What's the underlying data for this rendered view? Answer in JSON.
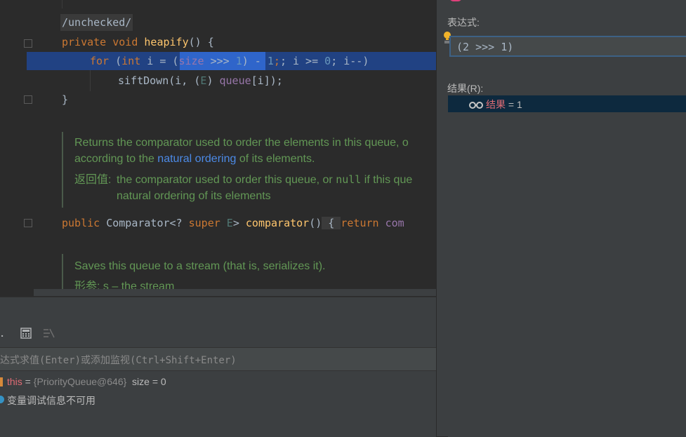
{
  "editor": {
    "comment_unchecked": "/unchecked/",
    "heapify_line": {
      "kw1": "private",
      "kw2": "void",
      "fn": "heapify",
      "rest": "() {"
    },
    "for_line": {
      "kw": "for",
      "open": " (",
      "kw2": "int",
      "mid": " i = ",
      "sel_open": "(",
      "sel_var": "size",
      "sel_op": " >>> ",
      "sel_num": "1",
      "sel_close": ")",
      "after1": " - ",
      "num1": "1",
      "semi1": "; i >= ",
      "num2": "0",
      "semi2": "; i--)"
    },
    "sift_line": {
      "text1": "siftDown(i, (",
      "type": "E",
      "text2": ") ",
      "field": "queue",
      "text3": "[i]);"
    },
    "close_brace": "}",
    "doc1_line1": "Returns the comparator used to order the elements in this queue, o",
    "doc1_line2_a": "according to the ",
    "doc1_line2_link": "natural ordering",
    "doc1_line2_b": " of its elements.",
    "doc1_ret_label": "返回值:",
    "doc1_ret_a": "the comparator used to order this queue, or ",
    "doc1_ret_null": "null",
    "doc1_ret_b": " if this que",
    "doc1_ret_line2": "natural ordering of its elements",
    "comparator_line": {
      "kw1": "public",
      "type": " Comparator<? ",
      "kw2": "super",
      "tp": " E",
      "gt": "> ",
      "fn": "comparator",
      "paren": "()",
      "brace": " { ",
      "kw3": "return",
      "rest": " com"
    },
    "doc2_line1": "Saves this queue to a stream (that is, serializes it).",
    "doc2_param_label": "形参:",
    "doc2_param": "s – the stream"
  },
  "right_panel": {
    "expression_label": "表达式:",
    "expression_value": "(2 >>> 1)",
    "result_label": "结果(R):",
    "result_name": "结果",
    "result_value": " = 1"
  },
  "bottom_panel": {
    "eval_placeholder": "达式求值(Enter)或添加监视(Ctrl+Shift+Enter)",
    "var_this_name": "this",
    "var_this_eq": " = ",
    "var_this_value": "{PriorityQueue@646}",
    "var_this_extra": "  size = 0",
    "info_message": "变量调试信息不可用"
  },
  "colors": {
    "highlight_line": "#214283",
    "selection": "#2f65ca",
    "result_row": "#0d293e"
  }
}
